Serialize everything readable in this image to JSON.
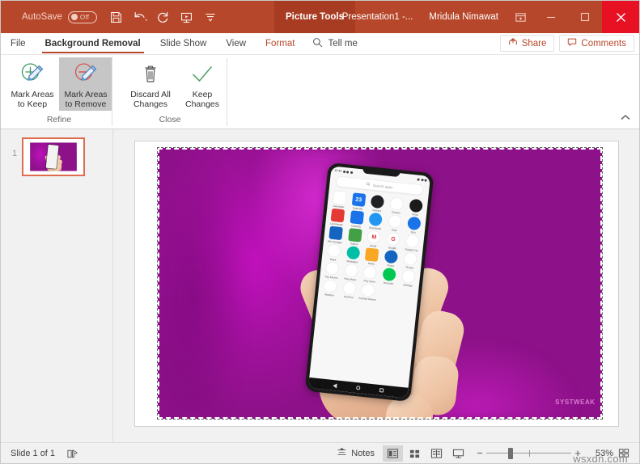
{
  "window": {
    "titlebar": {
      "autosave_label": "AutoSave",
      "autosave_state": "Off",
      "quick_access": [
        {
          "name": "save-icon",
          "label": "Save"
        },
        {
          "name": "undo-icon",
          "label": "Undo"
        },
        {
          "name": "redo-icon",
          "label": "Redo"
        },
        {
          "name": "start-presentation-icon",
          "label": "Start From Beginning"
        },
        {
          "name": "customize-qat-icon",
          "label": "Customize Quick Access Toolbar"
        }
      ],
      "contextual_tab": "Picture Tools",
      "document_title": "Presentation1  -...",
      "user_name": "Mridula Nimawat",
      "ribbon_display_options": "ribbon-display-options-icon",
      "minimize": "—",
      "restore": "❑",
      "close": "✕",
      "accent_color": "#b7472a",
      "contextual_color": "#a83c22",
      "close_color": "#e81123"
    },
    "tabs": [
      {
        "label": "File",
        "active": false,
        "contextual": false
      },
      {
        "label": "Background Removal",
        "active": true,
        "contextual": false
      },
      {
        "label": "Slide Show",
        "active": false,
        "contextual": false
      },
      {
        "label": "View",
        "active": false,
        "contextual": false
      },
      {
        "label": "Format",
        "active": false,
        "contextual": true
      }
    ],
    "tell_me": {
      "label": "Tell me",
      "icon": "search-icon"
    },
    "share_button": {
      "label": "Share",
      "icon": "share-icon"
    },
    "comments_button": {
      "label": "Comments",
      "icon": "comment-icon"
    }
  },
  "ribbon": {
    "collapse_label": "▲",
    "groups": [
      {
        "title": "Refine",
        "buttons": [
          {
            "label_line1": "Mark Areas",
            "label_line2": "to Keep",
            "icon": "mark-areas-to-keep-icon",
            "selected": false
          },
          {
            "label_line1": "Mark Areas",
            "label_line2": "to Remove",
            "icon": "mark-areas-to-remove-icon",
            "selected": true
          }
        ]
      },
      {
        "title": "Close",
        "buttons": [
          {
            "label_line1": "Discard All",
            "label_line2": "Changes",
            "icon": "discard-all-changes-icon",
            "selected": false
          },
          {
            "label_line1": "Keep",
            "label_line2": "Changes",
            "icon": "keep-changes-icon",
            "selected": false
          }
        ]
      }
    ]
  },
  "thumbnails": [
    {
      "number": "1",
      "selected": true
    }
  ],
  "slide": {
    "picture": {
      "selected": true,
      "watermark": "SYSTWEAK",
      "background_color": "#c011bc",
      "phone": {
        "status_time": "15:34",
        "search_placeholder": "Search apps",
        "apps": [
          {
            "label": "Calculator",
            "color": "#ffffff",
            "shape": "sq",
            "glyph": ""
          },
          {
            "label": "Calendar",
            "color": "#1a73e8",
            "shape": "sq",
            "glyph": "23"
          },
          {
            "label": "Camera",
            "color": "#202124",
            "shape": "circle",
            "glyph": ""
          },
          {
            "label": "Chrome",
            "color": "#ffffff",
            "shape": "circle",
            "glyph": ""
          },
          {
            "label": "Clock",
            "color": "#1b1b1b",
            "shape": "circle",
            "glyph": ""
          },
          {
            "label": "Community",
            "color": "#e53935",
            "shape": "sq",
            "glyph": ""
          },
          {
            "label": "Contacts",
            "color": "#1a73e8",
            "shape": "sq",
            "glyph": ""
          },
          {
            "label": "Downloads",
            "color": "#2196f3",
            "shape": "circle",
            "glyph": ""
          },
          {
            "label": "Drive",
            "color": "#ffffff",
            "shape": "circle",
            "glyph": ""
          },
          {
            "label": "Duo",
            "color": "#1a73e8",
            "shape": "circle",
            "glyph": ""
          },
          {
            "label": "File manager",
            "color": "#1565c0",
            "shape": "sq",
            "glyph": ""
          },
          {
            "label": "Gallery",
            "color": "#43a047",
            "shape": "sq",
            "glyph": ""
          },
          {
            "label": "Gmail",
            "color": "#ffffff",
            "shape": "circle",
            "glyph": "M"
          },
          {
            "label": "Google",
            "color": "#ffffff",
            "shape": "circle",
            "glyph": "G"
          },
          {
            "label": "Google Pay",
            "color": "#ffffff",
            "shape": "circle",
            "glyph": ""
          },
          {
            "label": "Maps",
            "color": "#ffffff",
            "shape": "circle",
            "glyph": ""
          },
          {
            "label": "Messages",
            "color": "#00bfa5",
            "shape": "circle",
            "glyph": ""
          },
          {
            "label": "Notes",
            "color": "#f9a825",
            "shape": "sq",
            "glyph": ""
          },
          {
            "label": "Phone",
            "color": "#1565c0",
            "shape": "circle",
            "glyph": ""
          },
          {
            "label": "Photos",
            "color": "#ffffff",
            "shape": "circle",
            "glyph": ""
          },
          {
            "label": "Play Movies",
            "color": "#ffffff",
            "shape": "circle",
            "glyph": ""
          },
          {
            "label": "Play Music",
            "color": "#ffffff",
            "shape": "circle",
            "glyph": ""
          },
          {
            "label": "Play Store",
            "color": "#ffffff",
            "shape": "circle",
            "glyph": ""
          },
          {
            "label": "Recorder",
            "color": "#00c853",
            "shape": "circle",
            "glyph": ""
          },
          {
            "label": "Settings",
            "color": "#ffffff",
            "shape": "circle",
            "glyph": ""
          },
          {
            "label": "Weather",
            "color": "#ffffff",
            "shape": "circle",
            "glyph": ""
          },
          {
            "label": "YouTube",
            "color": "#ffffff",
            "shape": "circle",
            "glyph": ""
          },
          {
            "label": "Android Cleaner",
            "color": "#ffffff",
            "shape": "circle",
            "glyph": ""
          }
        ],
        "nav": [
          "back-icon",
          "home-icon",
          "recents-icon"
        ]
      }
    }
  },
  "status_bar": {
    "slide_count": "Slide 1 of 1",
    "accessibility_icon": "accessibility-checker-icon",
    "notes_label": "Notes",
    "notes_icon": "notes-icon",
    "views": [
      {
        "name": "normal-view-button",
        "active": true
      },
      {
        "name": "slide-sorter-view-button",
        "active": false
      },
      {
        "name": "reading-view-button",
        "active": false
      },
      {
        "name": "slide-show-button",
        "active": false
      }
    ],
    "zoom_out": "−",
    "zoom_in": "+",
    "zoom_level": "53%",
    "fit_slide_icon": "fit-to-window-icon",
    "watermark": "wsxdn.com"
  }
}
